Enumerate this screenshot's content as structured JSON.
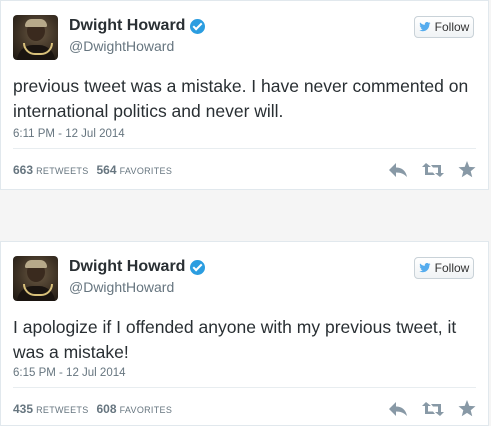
{
  "tweets": [
    {
      "name": "Dwight Howard",
      "handle": "@DwightHoward",
      "follow_label": "Follow",
      "text": "previous tweet was a mistake. I have never commented on international politics and never will.",
      "timestamp": "6:11 PM - 12 Jul 2014",
      "retweets_count": "663",
      "retweets_label": "RETWEETS",
      "favorites_count": "564",
      "favorites_label": "FAVORITES"
    },
    {
      "name": "Dwight Howard",
      "handle": "@DwightHoward",
      "follow_label": "Follow",
      "text": "I apologize if I offended anyone with my previous tweet, it was a mistake!",
      "timestamp": "6:15 PM - 12 Jul 2014",
      "retweets_count": "435",
      "retweets_label": "RETWEETS",
      "favorites_count": "608",
      "favorites_label": "FAVORITES"
    }
  ],
  "icons": {
    "verified": "verified-badge-icon",
    "follow": "twitter-bird-icon",
    "reply": "reply-icon",
    "retweet": "retweet-icon",
    "favorite": "star-icon"
  },
  "colors": {
    "verified_blue": "#2b9de0",
    "twitter_bird": "#55acee",
    "action_gray": "#8899a6"
  }
}
